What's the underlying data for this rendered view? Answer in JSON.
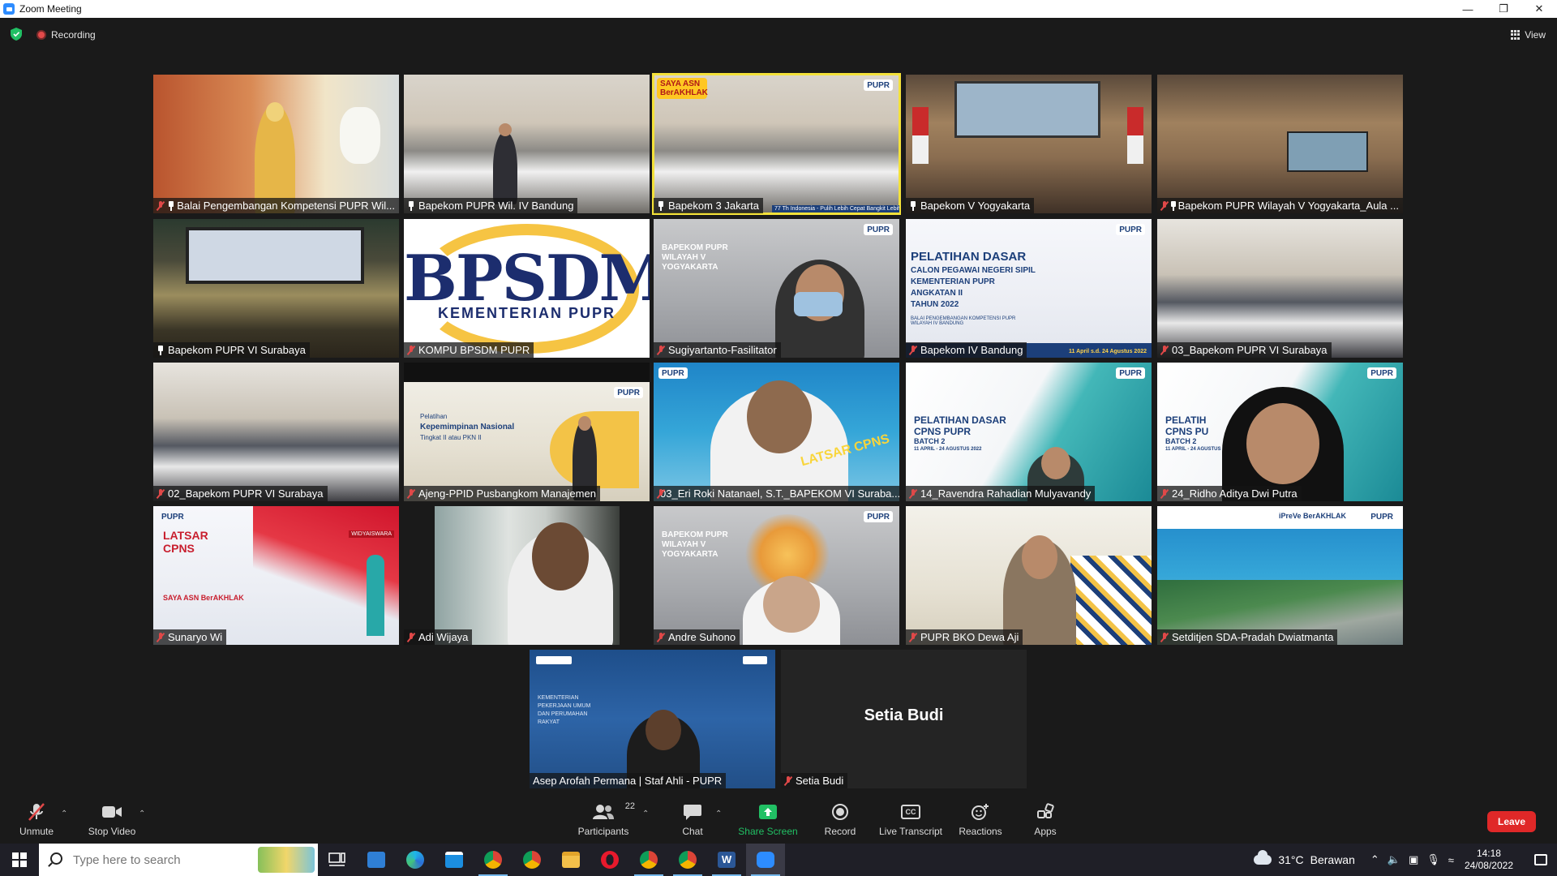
{
  "window": {
    "title": "Zoom Meeting"
  },
  "meeting": {
    "recording_label": "Recording",
    "view_label": "View"
  },
  "tiles": [
    {
      "name": "Balai Pengembangan Kompetensi PUPR Wil...",
      "muted": true,
      "pinned": true
    },
    {
      "name": "Bapekom PUPR Wil. IV Bandung",
      "muted": false,
      "pinned": true
    },
    {
      "name": "Bapekom 3 Jakarta",
      "muted": false,
      "pinned": true,
      "overlay": "77 Th Indonesia - Pulih Lebih Cepat Bangkit Lebih",
      "badge": "SAYA ASN BerAKHLAK",
      "brand": "PUPR"
    },
    {
      "name": "Bapekom V Yogyakarta",
      "muted": false,
      "pinned": true
    },
    {
      "name": "Bapekom PUPR Wilayah V Yogyakarta_Aula ...",
      "muted": true,
      "pinned": true
    },
    {
      "name": "Bapekom PUPR VI Surabaya",
      "muted": false,
      "pinned": true
    },
    {
      "name": "KOMPU BPSDM PUPR",
      "muted": true,
      "pinned": false,
      "logo_main": "BPSDM",
      "logo_sub": "KEMENTERIAN PUPR"
    },
    {
      "name": "Sugiyartanto-Fasilitator",
      "muted": true,
      "pinned": false,
      "slide": "BAPEKOM PUPR WILAYAH V YOGYAKARTA",
      "brand": "PUPR"
    },
    {
      "name": "Bapekom IV Bandung",
      "muted": true,
      "pinned": false,
      "slide_lines": [
        "PELATIHAN DASAR",
        "CALON PEGAWAI NEGERI SIPIL",
        "KEMENTERIAN PUPR",
        "ANGKATAN II",
        "TAHUN 2022"
      ],
      "slide_note": "BALAI PENGEMBANGAN KOMPETENSI PUPR WILAYAH IV BANDUNG",
      "date_strip": "11 April s.d. 24 Agustus 2022",
      "brand": "PUPR"
    },
    {
      "name": "03_Bapekom PUPR VI Surabaya",
      "muted": true,
      "pinned": false
    },
    {
      "name": "02_Bapekom PUPR VI Surabaya",
      "muted": true,
      "pinned": false
    },
    {
      "name": "Ajeng-PPID Pusbangkom Manajemen",
      "muted": true,
      "pinned": false,
      "slide_lines": [
        "Pelatihan",
        "Kepemimpinan Nasional",
        "Tingkat II atau PKN II"
      ],
      "brand": "PUPR"
    },
    {
      "name": "03_Eri Roki Natanael, S.T._BAPEKOM VI Suraba...",
      "muted": true,
      "pinned": false,
      "overlay": "LATSAR CPNS",
      "brand": "PUPR"
    },
    {
      "name": "14_Ravendra Rahadian Mulyavandy",
      "muted": true,
      "pinned": false,
      "slide_lines": [
        "PELATIHAN DASAR",
        "CPNS PUPR",
        "BATCH 2",
        "11 APRIL - 24 AGUSTUS 2022"
      ],
      "brand": "PUPR"
    },
    {
      "name": "24_Ridho Aditya Dwi Putra",
      "muted": true,
      "pinned": false,
      "slide_lines": [
        "PELATIH",
        "CPNS PU",
        "BATCH 2",
        "11 APRIL - 24 AGUSTUS"
      ],
      "brand": "PUPR"
    },
    {
      "name": "Sunaryo Wi",
      "muted": true,
      "pinned": false,
      "slide_lines": [
        "LATSAR",
        "CPNS"
      ],
      "badge": "SAYA ASN BerAKHLAK",
      "corner": "WIDYAISWARA",
      "brand": "PUPR"
    },
    {
      "name": "Adi Wijaya",
      "muted": true,
      "pinned": false
    },
    {
      "name": "Andre Suhono",
      "muted": true,
      "pinned": false,
      "slide": "BAPEKOM PUPR WILAYAH V YOGYAKARTA",
      "brand": "PUPR"
    },
    {
      "name": "PUPR BKO Dewa Aji",
      "muted": true,
      "pinned": false
    },
    {
      "name": "Setditjen SDA-Pradah Dwiatmanta",
      "muted": true,
      "pinned": false,
      "brand": "PUPR",
      "badge": "iPreVe BerAKHLAK"
    },
    {
      "name": "Asep Arofah Permana | Staf Ahli - PUPR",
      "muted": false,
      "pinned": false,
      "slide_lines": [
        "KEMENTERIAN",
        "PEKERJAAN UMUM",
        "DAN PERUMAHAN",
        "RAKYAT"
      ]
    },
    {
      "name": "Setia Budi",
      "muted": true,
      "pinned": false,
      "display_name": "Setia Budi"
    }
  ],
  "toolbar": {
    "unmute": "Unmute",
    "stop_video": "Stop Video",
    "participants": "Participants",
    "participants_count": "22",
    "chat": "Chat",
    "share_screen": "Share Screen",
    "record": "Record",
    "live_transcript": "Live Transcript",
    "live_transcript_icon": "CC",
    "reactions": "Reactions",
    "apps": "Apps",
    "leave": "Leave"
  },
  "taskbar": {
    "search_placeholder": "Type here to search",
    "weather_temp": "31°C",
    "weather_desc": "Berawan",
    "time": "14:18",
    "date": "24/08/2022"
  },
  "colors": {
    "accent": "#2d8cff",
    "share_green": "#21c064",
    "leave_red": "#e02828",
    "active_speaker": "#f4e23a",
    "muted_red": "#e04848"
  }
}
